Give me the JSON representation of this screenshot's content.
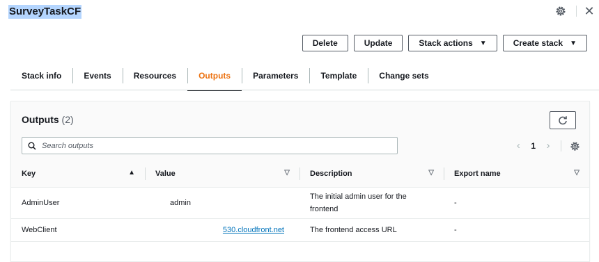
{
  "header": {
    "stack_name": "SurveyTaskCF",
    "close_glyph": "✕"
  },
  "actions": {
    "delete": "Delete",
    "update": "Update",
    "stack_actions": "Stack actions",
    "create_stack": "Create stack",
    "caret": "▼"
  },
  "tabs": [
    {
      "label": "Stack info"
    },
    {
      "label": "Events"
    },
    {
      "label": "Resources"
    },
    {
      "label": "Outputs",
      "active": true
    },
    {
      "label": "Parameters"
    },
    {
      "label": "Template"
    },
    {
      "label": "Change sets"
    }
  ],
  "outputs": {
    "title": "Outputs",
    "count": "(2)",
    "search_placeholder": "Search outputs",
    "page": "1",
    "columns": {
      "key": "Key",
      "value": "Value",
      "description": "Description",
      "export_name": "Export name"
    },
    "sort_asc": "▲",
    "sort_desc": "▽",
    "rows": [
      {
        "key": "AdminUser",
        "value": "admin",
        "description": "The initial admin user for the frontend",
        "export_name": "-"
      },
      {
        "key": "WebClient",
        "value": "530.cloudfront.net",
        "description": "The frontend access URL",
        "export_name": "-"
      }
    ]
  },
  "colors": {
    "accent": "#ec7211",
    "link": "#0073bb",
    "highlight": "#b4d5fe"
  }
}
